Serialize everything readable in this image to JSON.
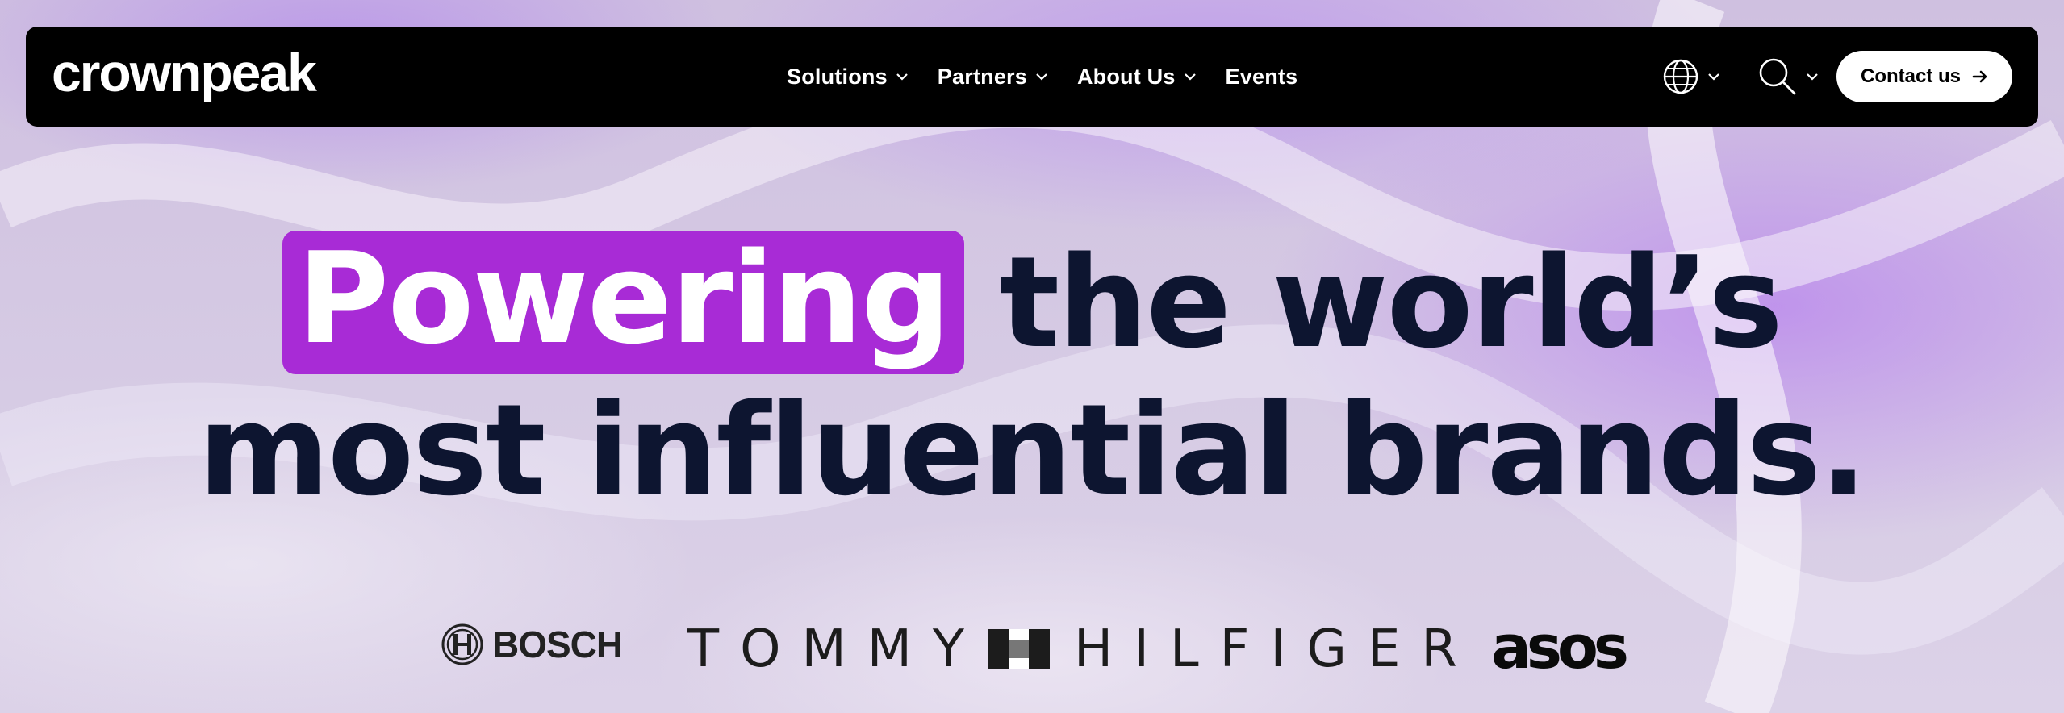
{
  "brand": {
    "logo_text": "crownpeak"
  },
  "nav": {
    "items": [
      {
        "label": "Solutions",
        "has_dropdown": true
      },
      {
        "label": "Partners",
        "has_dropdown": true
      },
      {
        "label": "About Us",
        "has_dropdown": true
      },
      {
        "label": "Events",
        "has_dropdown": false
      }
    ],
    "language_icon": "globe-icon",
    "search_icon": "search-icon",
    "contact_label": "Contact us"
  },
  "hero": {
    "highlight_word": "Powering",
    "line1_rest": "the world’s",
    "line2": "most influential brands.",
    "highlight_color": "#a82bd6",
    "text_color": "#0d1530"
  },
  "brands": {
    "bosch": "BOSCH",
    "tommy_left": "TOMMY",
    "tommy_right": "HILFIGER",
    "asos": "asos"
  }
}
